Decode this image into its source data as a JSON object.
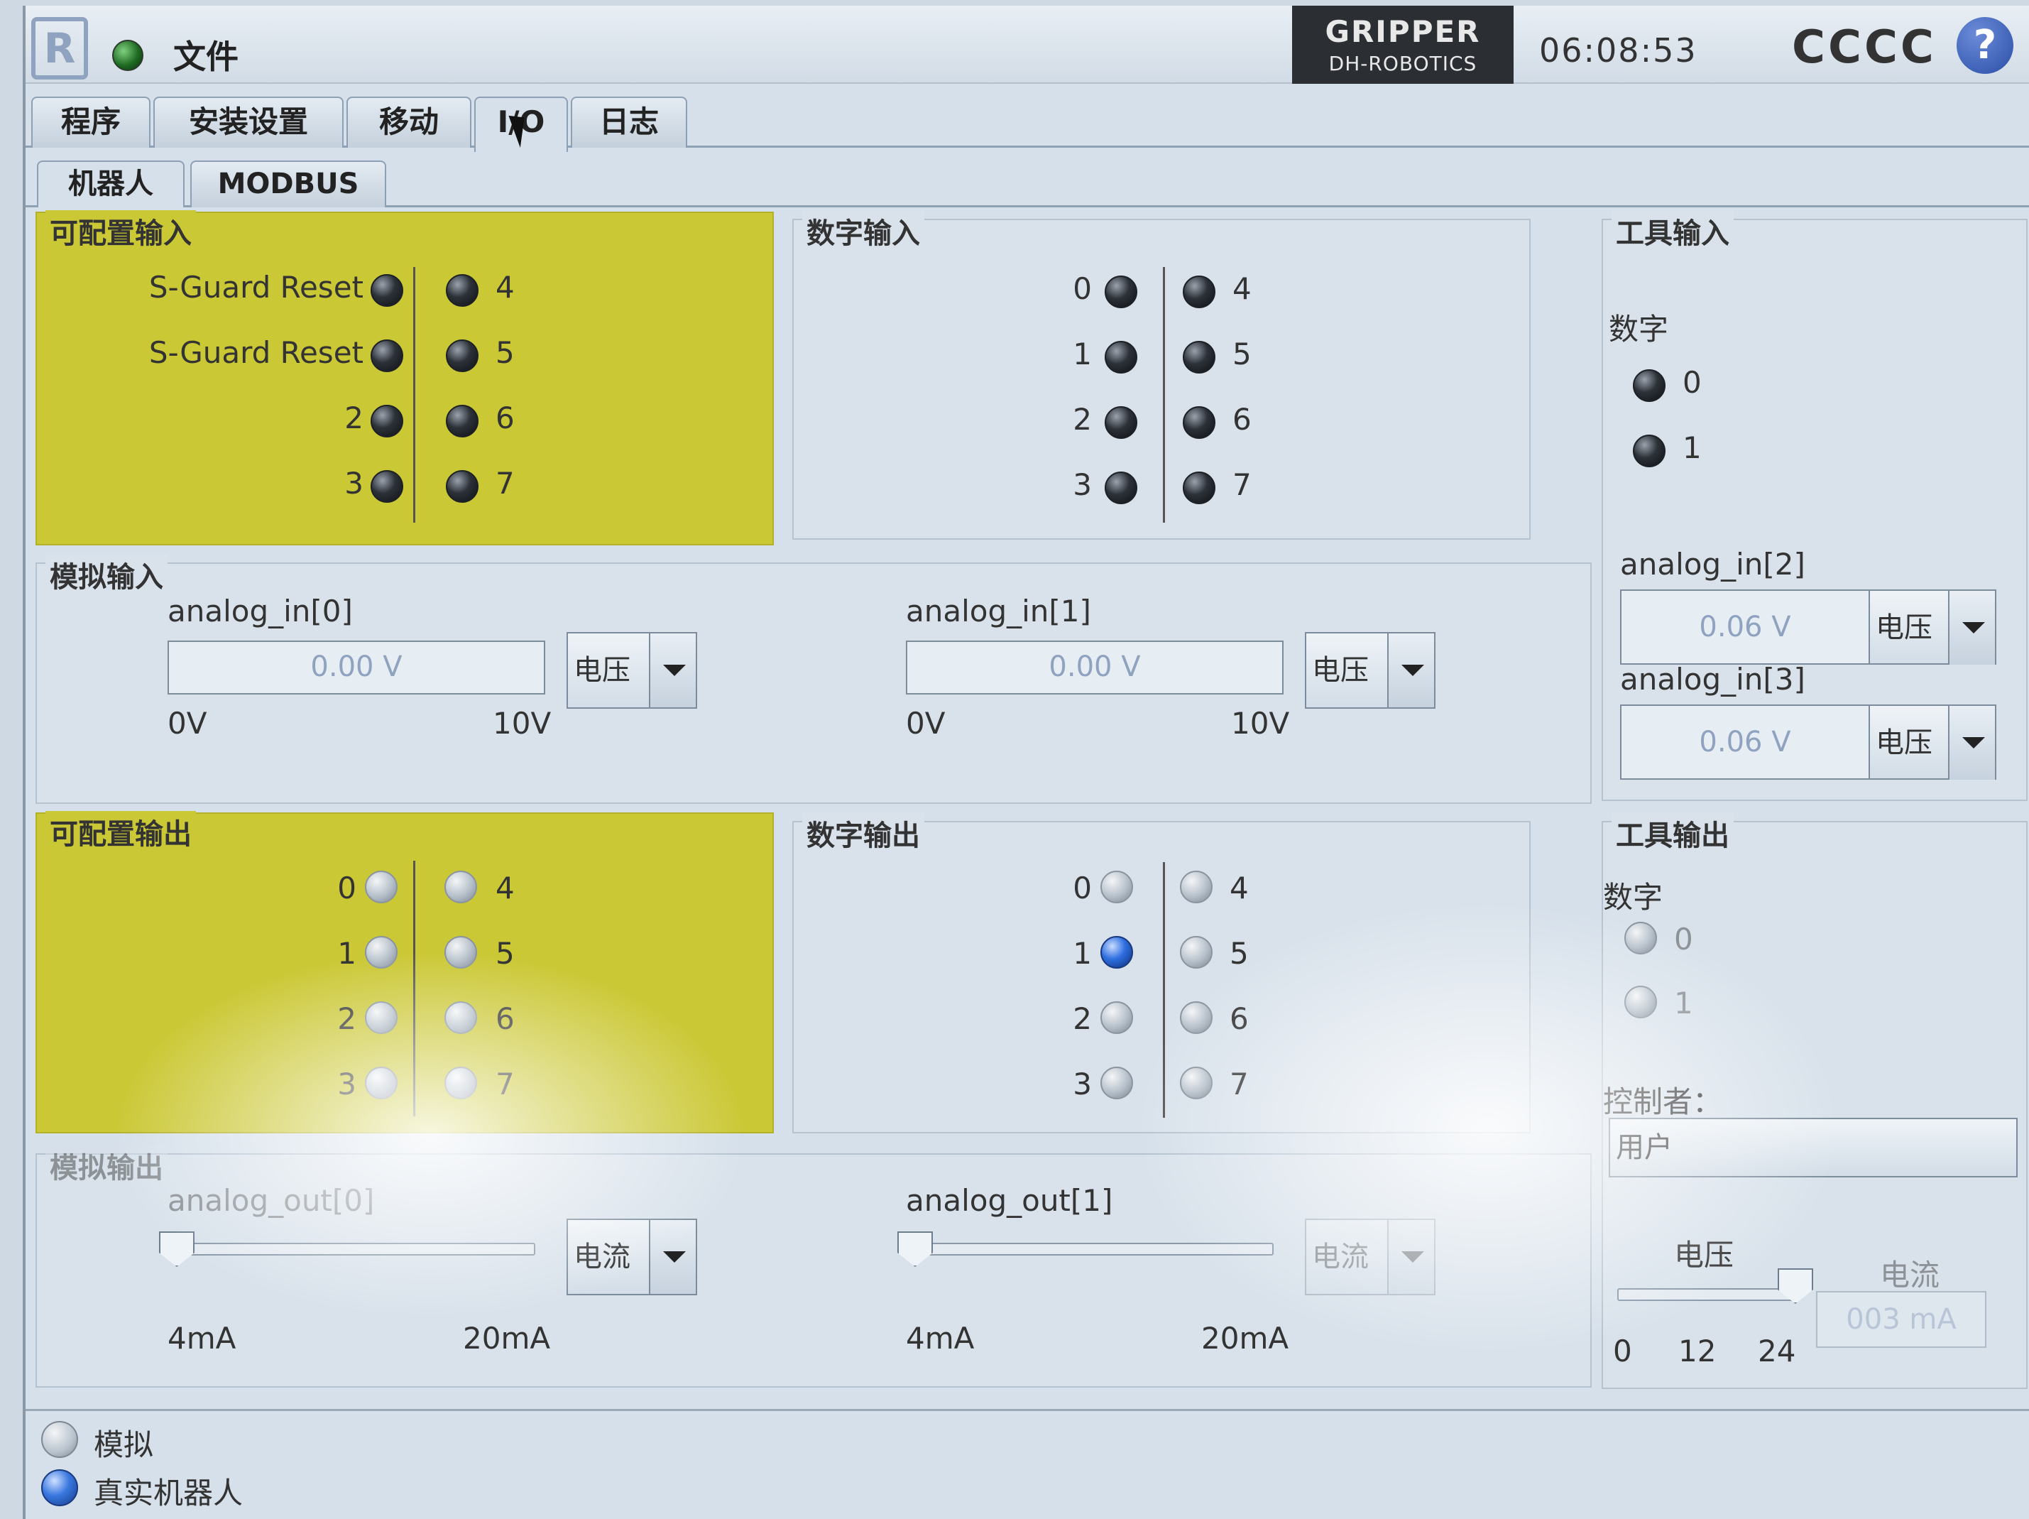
{
  "header": {
    "file_menu": "文件",
    "gripper_title": "GRIPPER",
    "gripper_sub": "DH-ROBOTICS",
    "time": "06:08:53",
    "robot_name": "CCCC",
    "help": "?"
  },
  "tabs": [
    {
      "label": "程序"
    },
    {
      "label": "安装设置"
    },
    {
      "label": "移动"
    },
    {
      "label": "I/O"
    },
    {
      "label": "日志"
    }
  ],
  "subtabs": [
    {
      "label": "机器人"
    },
    {
      "label": "MODBUS"
    }
  ],
  "config_input": {
    "title": "可配置输入",
    "left": [
      {
        "label": "S-Guard Reset"
      },
      {
        "label": "S-Guard Reset"
      },
      {
        "label": "2"
      },
      {
        "label": "3"
      }
    ],
    "right": [
      {
        "label": "4"
      },
      {
        "label": "5"
      },
      {
        "label": "6"
      },
      {
        "label": "7"
      }
    ]
  },
  "digital_input": {
    "title": "数字输入",
    "left": [
      {
        "label": "0"
      },
      {
        "label": "1"
      },
      {
        "label": "2"
      },
      {
        "label": "3"
      }
    ],
    "right": [
      {
        "label": "4"
      },
      {
        "label": "5"
      },
      {
        "label": "6"
      },
      {
        "label": "7"
      }
    ]
  },
  "tool_input": {
    "title": "工具输入",
    "digital_label": "数字",
    "digital": [
      {
        "label": "0"
      },
      {
        "label": "1"
      }
    ],
    "analog": [
      {
        "name": "analog_in[2]",
        "value": "0.06 V",
        "mode": "电压"
      },
      {
        "name": "analog_in[3]",
        "value": "0.06 V",
        "mode": "电压"
      }
    ]
  },
  "analog_input": {
    "title": "模拟输入",
    "channels": [
      {
        "name": "analog_in[0]",
        "value": "0.00 V",
        "mode": "电压",
        "min": "0V",
        "max": "10V"
      },
      {
        "name": "analog_in[1]",
        "value": "0.00 V",
        "mode": "电压",
        "min": "0V",
        "max": "10V"
      }
    ]
  },
  "config_output": {
    "title": "可配置输出",
    "left": [
      {
        "label": "0"
      },
      {
        "label": "1"
      },
      {
        "label": "2"
      },
      {
        "label": "3"
      }
    ],
    "right": [
      {
        "label": "4"
      },
      {
        "label": "5"
      },
      {
        "label": "6"
      },
      {
        "label": "7"
      }
    ]
  },
  "digital_output": {
    "title": "数字输出",
    "left": [
      {
        "label": "0",
        "on": false
      },
      {
        "label": "1",
        "on": true
      },
      {
        "label": "2",
        "on": false
      },
      {
        "label": "3",
        "on": false
      }
    ],
    "right": [
      {
        "label": "4",
        "on": false
      },
      {
        "label": "5",
        "on": false
      },
      {
        "label": "6",
        "on": false
      },
      {
        "label": "7",
        "on": false
      }
    ]
  },
  "tool_output": {
    "title": "工具输出",
    "digital_label": "数字",
    "digital": [
      {
        "label": "0"
      },
      {
        "label": "1"
      }
    ],
    "controller_label": "控制者：",
    "controller_value": "用户",
    "voltage_label": "电压",
    "voltage_ticks": [
      "0",
      "12",
      "24"
    ],
    "voltage_value": 24,
    "current_label": "电流",
    "current_value": "003 mA"
  },
  "analog_output": {
    "title": "模拟输出",
    "channels": [
      {
        "name": "analog_out[0]",
        "mode": "电流",
        "min": "4mA",
        "max": "20mA",
        "value_fraction": 0
      },
      {
        "name": "analog_out[1]",
        "mode": "电流",
        "min": "4mA",
        "max": "20mA",
        "value_fraction": 0
      }
    ]
  },
  "mode": {
    "options": [
      {
        "label": "模拟",
        "checked": false
      },
      {
        "label": "真实机器人",
        "checked": true
      }
    ]
  },
  "colors": {
    "yellow_panel": "#cbc836",
    "background": "#d6e0ea",
    "active_led": "#2f6fe0"
  }
}
